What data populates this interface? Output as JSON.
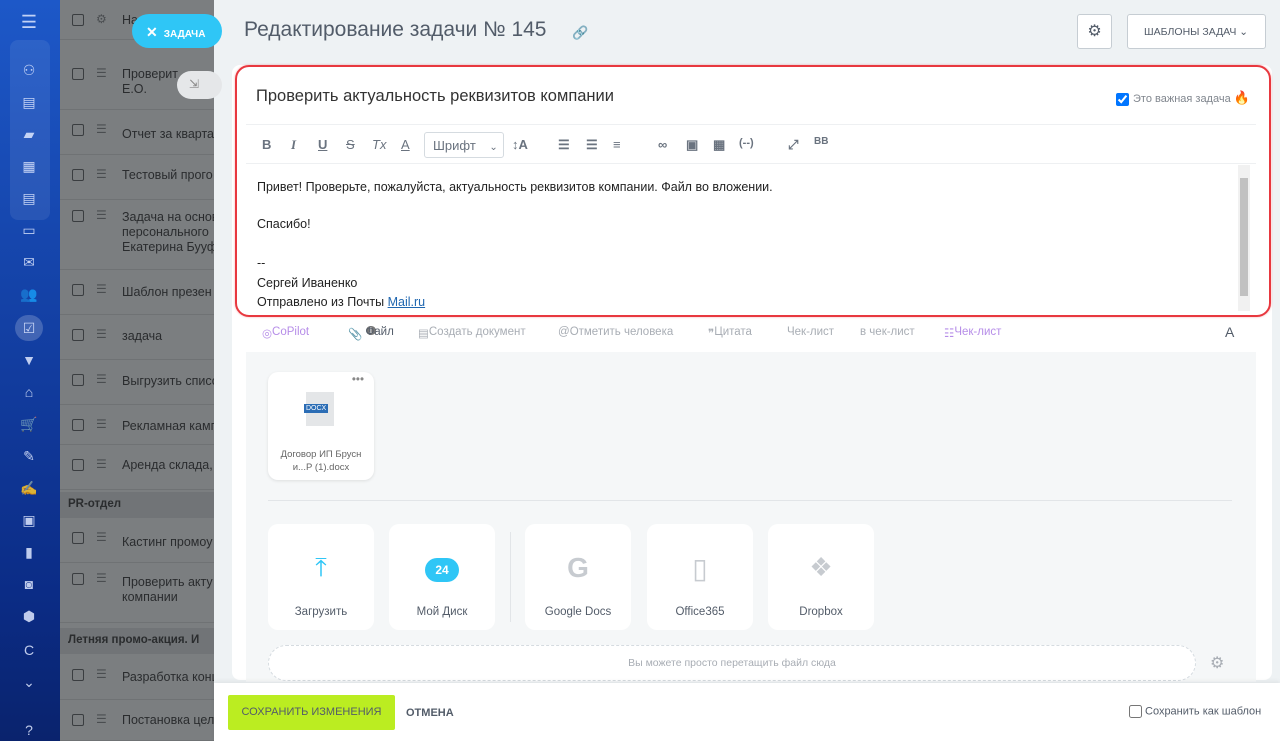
{
  "sidebar": {
    "icons": [
      "menu-icon",
      "sites-icon",
      "feed-icon",
      "chat-icon",
      "calendar-icon",
      "docs-icon",
      "drive-icon",
      "mail-icon",
      "employees-icon",
      "tasks-icon",
      "crm-funnel-icon",
      "shop-icon",
      "cart-icon",
      "sign-icon",
      "signature-icon",
      "contacts-icon",
      "analytics-icon",
      "robot-icon",
      "inventory-icon",
      "c-icon",
      "more-icon",
      "help-icon"
    ],
    "c_label": "C"
  },
  "task_list": {
    "header": "На",
    "rows": [
      "Проверит\nЕ.О.",
      "Отчет за кварта",
      "Тестовый прого",
      "Задача на основ\nперсонального\nЕкатерина Бууфф",
      "Шаблон презен",
      "задача",
      "Выгрузить списо",
      "Рекламная камп",
      "Аренда склада, у"
    ],
    "group1": "PR-отдел",
    "rows2": [
      "Кастинг промоу",
      "Проверить акту\nкомпании"
    ],
    "group2": "Летняя промо-акция. И",
    "rows3": [
      "Разработка конц",
      "Постановка цел"
    ]
  },
  "close_button": "ЗАДАЧА",
  "header": {
    "title": "Редактирование задачи № 145",
    "templates_label": "ШАБЛОНЫ ЗАДАЧ"
  },
  "task": {
    "name": "Проверить актуальность реквизитов компании",
    "important_label": "Это важная задача",
    "important_checked": true
  },
  "toolbar": {
    "bold": "B",
    "italic": "I",
    "underline": "U",
    "strike": "S",
    "clear": "Tx",
    "color": "A",
    "font": "Шрифт",
    "size": "↕A",
    "bb": "BB"
  },
  "body": {
    "line1": "Привет! Проверьте, пожалуйста, актуальность реквизитов компании. Файл во вложении.",
    "line2": "Спасибо!",
    "line3": "--",
    "line4": "Сергей Иваненко",
    "line5_prefix": "Отправлено из Почты ",
    "line5_link": "Mail.ru"
  },
  "actions": {
    "copilot": "CoPilot",
    "file": "Файл",
    "file_count": "1",
    "create_doc": "Создать документ",
    "mention": "Отметить человека",
    "quote": "Цитата",
    "checklist": "Чек-лист",
    "to_checklist": "в чек-лист",
    "checklist2": "Чек-лист",
    "font_toggle": "A"
  },
  "attachment": {
    "badge": "DOCX",
    "name": "Договор ИП Брусн\nи...Р (1).docx"
  },
  "sources": [
    {
      "label": "Загрузить",
      "icon": "upload-icon"
    },
    {
      "label": "Мой Диск",
      "icon": "disk-24-icon",
      "badge": "24"
    },
    {
      "label": "Google Docs",
      "icon": "google-icon"
    },
    {
      "label": "Office365",
      "icon": "office-icon"
    },
    {
      "label": "Dropbox",
      "icon": "dropbox-icon"
    }
  ],
  "drop_hint": "Вы можете просто перетащить файл сюда",
  "footer": {
    "save": "СОХРАНИТЬ ИЗМЕНЕНИЯ",
    "cancel": "ОТМЕНА",
    "save_as_template": "Сохранить как шаблон"
  },
  "colors": {
    "accent": "#2fc6f6",
    "save": "#bbed21",
    "highlight": "#e8383f"
  }
}
